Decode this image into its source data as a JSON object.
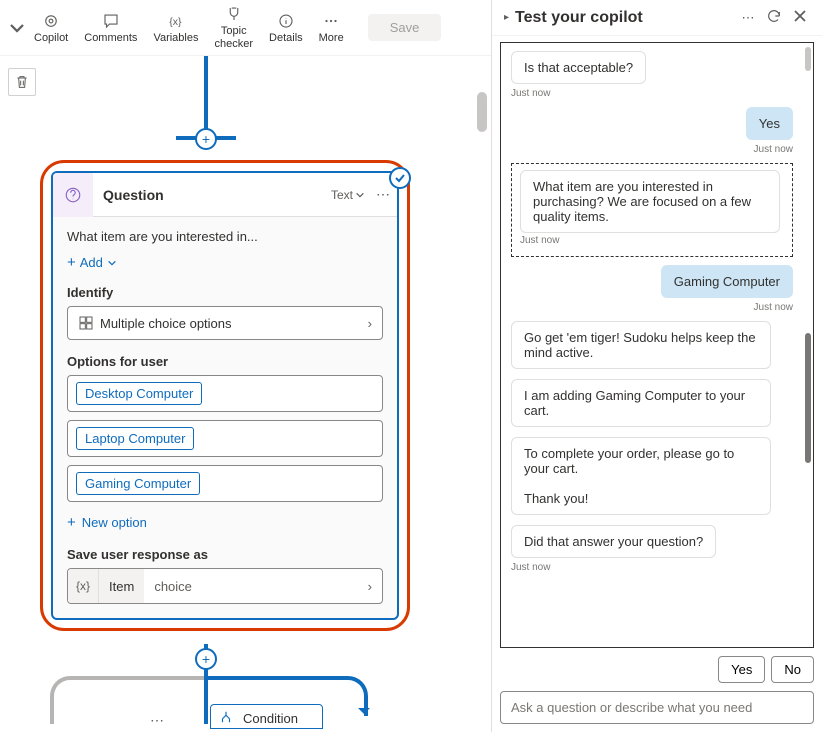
{
  "toolbar": {
    "copilot": "Copilot",
    "comments": "Comments",
    "variables": "Variables",
    "topic_checker": "Topic\nchecker",
    "details": "Details",
    "more": "More",
    "save": "Save"
  },
  "card": {
    "title": "Question",
    "text_label": "Text",
    "question_text": "What item are you interested in...",
    "add_label": "Add",
    "identify_label": "Identify",
    "identify_value": "Multiple choice options",
    "options_label": "Options for user",
    "options": [
      "Desktop Computer",
      "Laptop Computer",
      "Gaming Computer"
    ],
    "new_option": "New option",
    "save_resp_label": "Save user response as",
    "var_symbol": "{x}",
    "var_name": "Item",
    "var_type": "choice"
  },
  "condition_label": "Condition",
  "test_panel": {
    "title": "Test your copilot",
    "msg1": "Is that acceptable?",
    "ts": "Just now",
    "reply1": "Yes",
    "msg2": "What item are you interested in purchasing? We are focused on a few quality items.",
    "reply2": "Gaming Computer",
    "msg3": "Go get 'em tiger! Sudoku helps keep the mind active.",
    "msg4": "I am adding Gaming Computer to your cart.",
    "msg5": "To complete your order, please go to your cart.",
    "msg5b": "Thank you!",
    "msg6": "Did that answer your question?",
    "yes": "Yes",
    "no": "No",
    "ask_placeholder": "Ask a question or describe what you need"
  }
}
